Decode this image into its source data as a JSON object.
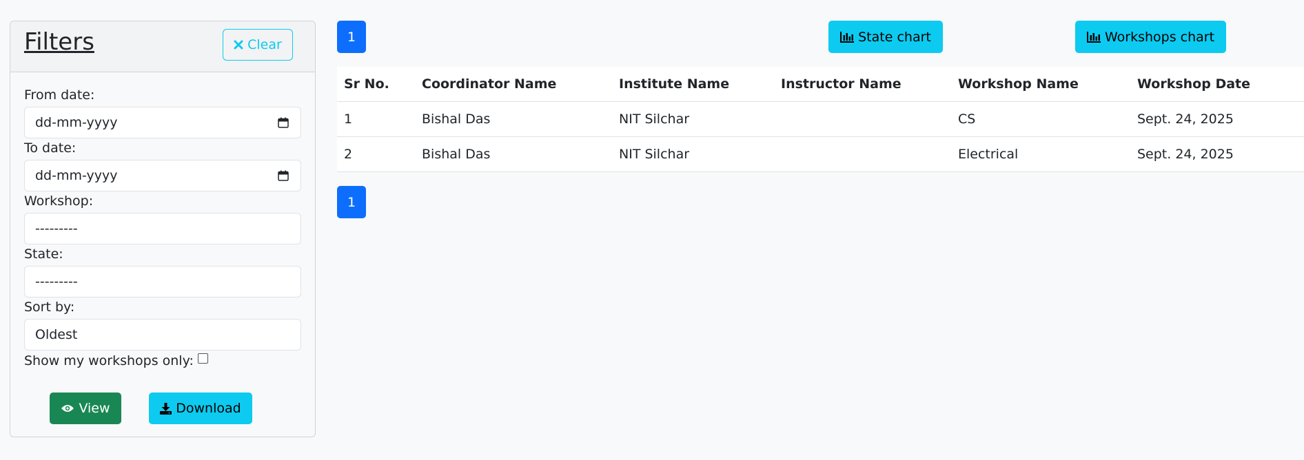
{
  "filters": {
    "title": "Filters",
    "clear_label": "Clear",
    "from_date_label": "From date:",
    "from_date_placeholder": "dd-mm-yyyy",
    "to_date_label": "To date:",
    "to_date_placeholder": "dd-mm-yyyy",
    "workshop_label": "Workshop:",
    "workshop_value": "---------",
    "state_label": "State:",
    "state_value": "---------",
    "sort_label": "Sort by:",
    "sort_value": "Oldest",
    "show_mine_label": "Show my workshops only:",
    "show_mine_checked": false,
    "view_label": "View",
    "download_label": "Download"
  },
  "pagination": {
    "page": "1"
  },
  "charts": {
    "state_chart_label": "State chart",
    "workshops_chart_label": "Workshops chart"
  },
  "table": {
    "headers": [
      "Sr No.",
      "Coordinator Name",
      "Institute Name",
      "Instructor Name",
      "Workshop Name",
      "Workshop Date"
    ],
    "rows": [
      [
        "1",
        "Bishal Das",
        "NIT Silchar",
        "",
        "CS",
        "Sept. 24, 2025"
      ],
      [
        "2",
        "Bishal Das",
        "NIT Silchar",
        "",
        "Electrical",
        "Sept. 24, 2025"
      ]
    ]
  },
  "colors": {
    "primary": "#0d6efd",
    "info": "#0dcaf0",
    "success": "#198754"
  },
  "icons": {
    "clear": "times-icon",
    "calendar": "calendar-icon",
    "view": "eye-icon",
    "download": "download-icon",
    "chart": "bar-chart-icon"
  }
}
